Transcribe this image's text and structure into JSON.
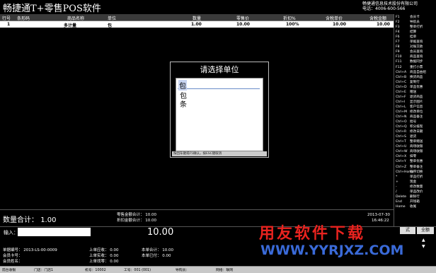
{
  "app": {
    "title": "畅捷通T+零售POS软件",
    "company": "畅捷通信息技术股份有限公司",
    "phone": "电话：4006-600-566"
  },
  "table": {
    "headers": [
      "行号",
      "条形码",
      "商品名称",
      "单位",
      "数量",
      "零售价",
      "折扣%",
      "含税单价",
      "含税金额"
    ],
    "rows": [
      [
        "1",
        "",
        "多计量",
        "包",
        "1.00",
        "10.00",
        "100%",
        "10.00",
        "10.00"
      ]
    ]
  },
  "sidebar": [
    [
      "F1",
      "会员卡"
    ],
    [
      "F2",
      "导航员"
    ],
    [
      "F3",
      "整单打折"
    ],
    [
      "F4",
      "结算"
    ],
    [
      "F6",
      "挂单"
    ],
    [
      "F7",
      "单据查询"
    ],
    [
      "F8",
      "对账交款"
    ],
    [
      "F9",
      "会员查询"
    ],
    [
      "F10",
      "商品查询"
    ],
    [
      "F11",
      "数据同步"
    ],
    [
      "F12",
      "重打小票"
    ],
    [
      "Ctrl+A",
      "商品自由组"
    ],
    [
      "Ctrl+B",
      "换货商品"
    ],
    [
      "Ctrl+C",
      "复制行"
    ],
    [
      "Ctrl+D",
      "单品优惠"
    ],
    [
      "Ctrl+E",
      "赠送"
    ],
    [
      "Ctrl+F",
      "退货商品"
    ],
    [
      "Ctrl+I",
      "显示图片"
    ],
    [
      "Ctrl+L",
      "客户信息"
    ],
    [
      "Ctrl+M",
      "修改单位"
    ],
    [
      "Ctrl+N",
      "商品备注"
    ],
    [
      "Ctrl+O",
      "批号"
    ],
    [
      "Ctrl+Q",
      "积分抵现"
    ],
    [
      "Ctrl+R",
      "修改日期"
    ],
    [
      "Ctrl+S",
      "退货"
    ],
    [
      "Ctrl+T",
      "整单赠送"
    ],
    [
      "Ctrl+U",
      "商场收银"
    ],
    [
      "Ctrl+W",
      "商场收银"
    ],
    [
      "Ctrl+X",
      "抹零"
    ],
    [
      "Ctrl+Y",
      "整单优惠"
    ],
    [
      "Ctrl+Z",
      "整单备注"
    ],
    [
      "Ctrl+Home",
      "程序切换"
    ],
    [
      "*",
      "单品打折"
    ],
    [
      "+",
      "现金"
    ],
    [
      "-",
      "修改数量"
    ],
    [
      "/",
      "单品改价"
    ],
    [
      "Delete",
      "删除行"
    ],
    [
      "End",
      "开钱箱"
    ],
    [
      "Home",
      "收尾"
    ]
  ],
  "dialog": {
    "title": "请选择单位",
    "input_value": "包",
    "options": [
      "包",
      "条"
    ],
    "hint": "按回车键或F5确认，按ESC键取消"
  },
  "totals": {
    "qty_label": "数量合计：",
    "qty_value": "1.00",
    "retail_total": "零售金额合计：   10.00",
    "discount_total": "折扣金额合计：   10.00",
    "date": "2013-07-30",
    "time": "16:46:22"
  },
  "input": {
    "label": "输入：",
    "value": "",
    "amount": "10.00"
  },
  "buttons": {
    "style": "式",
    "all": "全额"
  },
  "logo": {
    "text": "用友软件下载",
    "url": "WWW.YYRJXZ.COM"
  },
  "info": {
    "bill_no": "单据编号：   2013-LS-00-0009",
    "member_card": "会员卡号：",
    "member_points": "会员姓名：",
    "last_receivable": "上单应收：   0.00",
    "last_received": "上单实收：   0.00",
    "last_change": "上单找零：   0.00",
    "current_total": "本单合计：   10.00",
    "current_paid": "本单已付：   0.00"
  },
  "status": [
    "前台收银",
    "门店：门店1",
    "机号：10002",
    "工号：001 (001)",
    "导购员：",
    "网络：联网"
  ],
  "colors": {
    "logo_red": "#e8231f",
    "logo_blue": "#3a6ad8"
  }
}
